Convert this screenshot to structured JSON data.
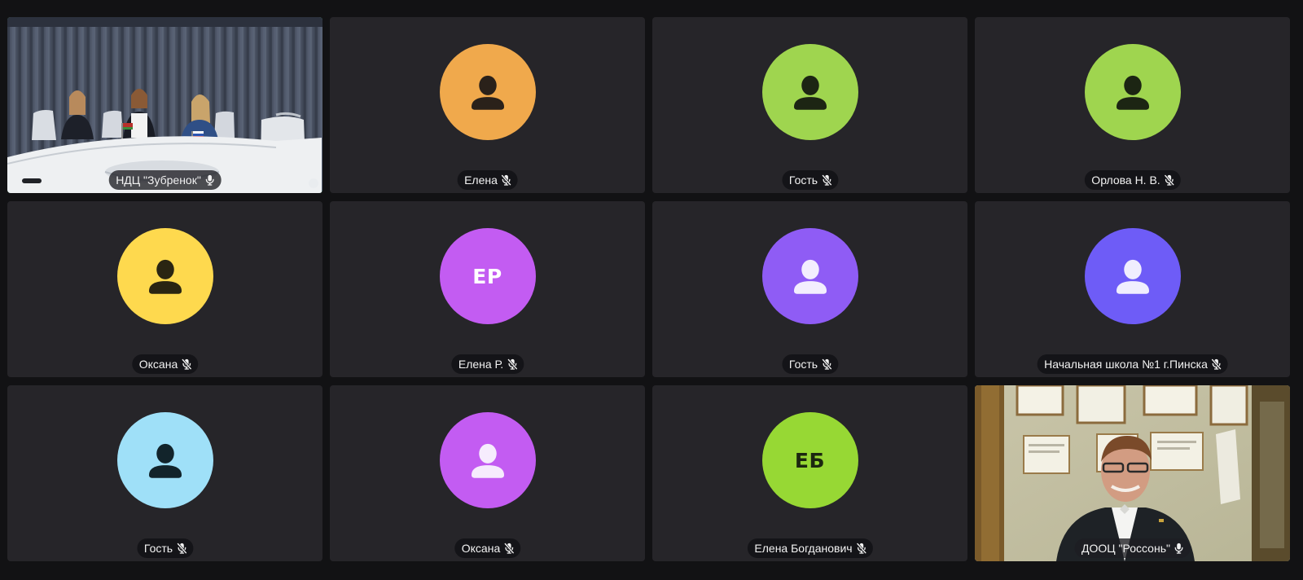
{
  "participants": [
    {
      "name": "НДЦ \"Зубренок\"",
      "type": "video-meeting",
      "mic": "unmuted",
      "speaking": true
    },
    {
      "name": "Елена",
      "type": "avatar",
      "icon": "person-icon",
      "avatar_color": "#f0a94c",
      "glyph_color": "#2a211a",
      "mic": "muted"
    },
    {
      "name": "Гость",
      "type": "avatar",
      "icon": "person-icon",
      "avatar_color": "#9fd54f",
      "glyph_color": "#1c2513",
      "mic": "muted"
    },
    {
      "name": "Орлова Н. В.",
      "type": "avatar",
      "icon": "person-icon",
      "avatar_color": "#9fd54f",
      "glyph_color": "#1c2513",
      "mic": "muted"
    },
    {
      "name": "Оксана",
      "type": "avatar",
      "icon": "person-icon",
      "avatar_color": "#fed94e",
      "glyph_color": "#2a2512",
      "mic": "muted"
    },
    {
      "name": "Елена Р.",
      "type": "initials",
      "initials": "ЕР",
      "avatar_color": "#c35cf2",
      "glyph_color": "#ffffff",
      "mic": "muted"
    },
    {
      "name": "Гость",
      "type": "avatar",
      "icon": "person-icon",
      "avatar_color": "#8f5cf5",
      "glyph_color": "#f3eefe",
      "mic": "muted"
    },
    {
      "name": "Начальная школа №1 г.Пинска",
      "type": "avatar",
      "icon": "person-icon",
      "avatar_color": "#6e5cf7",
      "glyph_color": "#f0eefe",
      "mic": "muted"
    },
    {
      "name": "Гость",
      "type": "avatar",
      "icon": "person-icon",
      "avatar_color": "#9fe0f8",
      "glyph_color": "#12242b",
      "mic": "muted"
    },
    {
      "name": "Оксана",
      "type": "avatar",
      "icon": "person-icon",
      "avatar_color": "#c35cf2",
      "glyph_color": "#f6ecfd",
      "mic": "muted"
    },
    {
      "name": "Елена Богданович",
      "type": "initials",
      "initials": "ЕБ",
      "avatar_color": "#97d834",
      "glyph_color": "#1c2710",
      "mic": "muted"
    },
    {
      "name": "ДООЦ \"Россонь\"",
      "type": "video-office",
      "mic": "unmuted",
      "speaking": false
    }
  ]
}
